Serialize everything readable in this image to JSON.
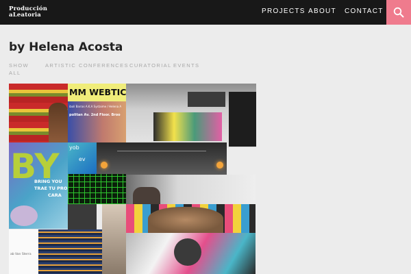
{
  "header": {
    "logo_line1": "Producción",
    "logo_line2": "aLeatoria",
    "nav": [
      {
        "label": "PROJECTS"
      },
      {
        "label": "ABOUT"
      },
      {
        "label": "CONTACT"
      }
    ],
    "search_icon": "search-icon",
    "accent_color": "#ef7b8d"
  },
  "page": {
    "title": "by Helena Acosta"
  },
  "filters": [
    {
      "label": "SHOW"
    },
    {
      "label": "ALL"
    },
    {
      "label": "ARTISTIC"
    },
    {
      "label": "CONFERENCES"
    },
    {
      "label": "CURATORIAL"
    },
    {
      "label": "EVENTS"
    }
  ],
  "tiles": [
    {
      "caption": "MM WEBTICS",
      "sub": "ibolí Barras A.K.A Systaime / Helena A",
      "sub2": "politan Av. 2nd Floor. Broo"
    },
    {
      "caption": "BRING YOU",
      "sub": "TRAE TU PRO",
      "sub2": "CARA"
    },
    {
      "caption": "yob",
      "sub": "ev"
    },
    {
      "caption": "ab Van Sterra"
    }
  ]
}
